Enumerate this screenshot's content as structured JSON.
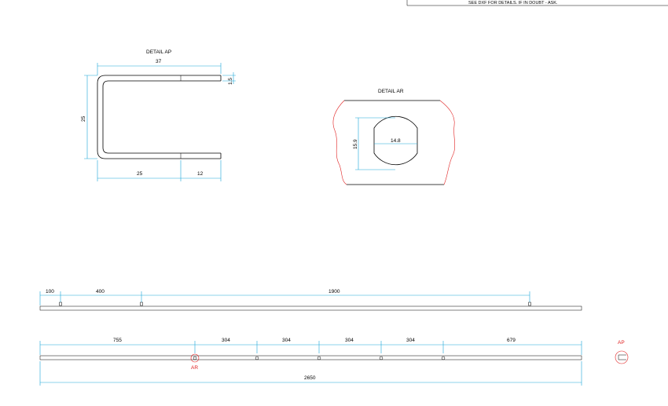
{
  "note": "SEE DXF FOR DETAILS.   IF IN DOUBT - ASK.",
  "detail_ap": {
    "title": "DETAIL AP",
    "dim_width": "37",
    "dim_thickness": "1.5",
    "dim_height": "25",
    "dim_bottom_left": "25",
    "dim_bottom_right": "12"
  },
  "detail_ar": {
    "title": "DETAIL AR",
    "dim_hole_height": "15.9",
    "dim_hole_width": "14.8"
  },
  "top_bar": {
    "dims": [
      "100",
      "400",
      "1900"
    ]
  },
  "bottom_bar": {
    "dims": [
      "755",
      "304",
      "304",
      "304",
      "304",
      "679"
    ],
    "overall": "2650",
    "callout_ar": "AR",
    "callout_ap": "AP"
  },
  "colors": {
    "dimension": "#1aa7d8",
    "callout": "#e02020",
    "geometry": "#000000"
  }
}
